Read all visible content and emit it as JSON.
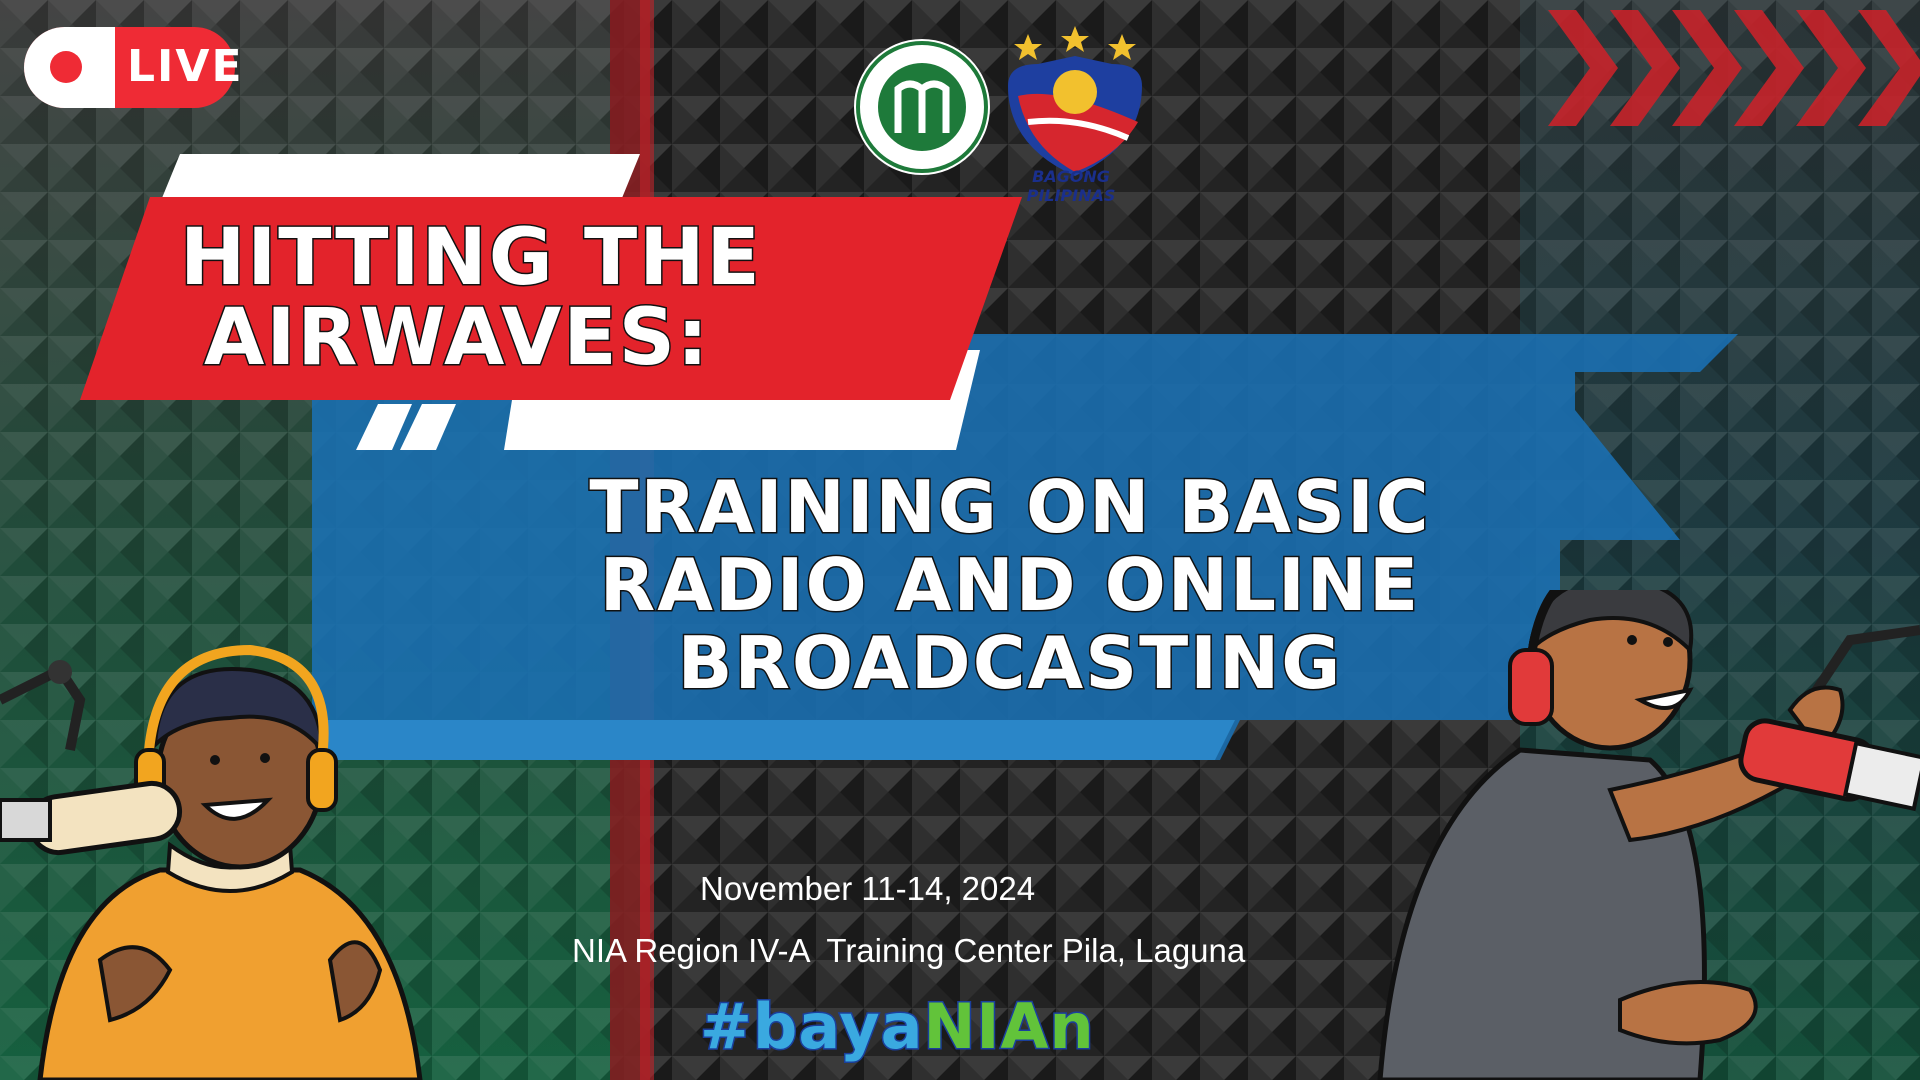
{
  "badge": {
    "live_label": "LIVE"
  },
  "logos": {
    "nia": {
      "icon": "nia-seal-logo"
    },
    "bagong_pilipinas": {
      "icon": "bagong-pilipinas-logo",
      "text": "BAGONG PILIPINAS"
    }
  },
  "title": {
    "line1": "HITTING THE",
    "line2": "AIRWAVES:",
    "sub1": "TRAINING ON BASIC",
    "sub2": "RADIO AND ONLINE",
    "sub3": "BROADCASTING"
  },
  "event": {
    "date": "November 11-14, 2024",
    "venue": "NIA Region IV-A  Training Center Pila, Laguna",
    "hashtag_a": "#baya",
    "hashtag_b": "NIAn"
  },
  "colors": {
    "red": "#e3232b",
    "blue": "#1b6fb0",
    "green": "#1f6a45",
    "accent_green": "#62c33a"
  }
}
